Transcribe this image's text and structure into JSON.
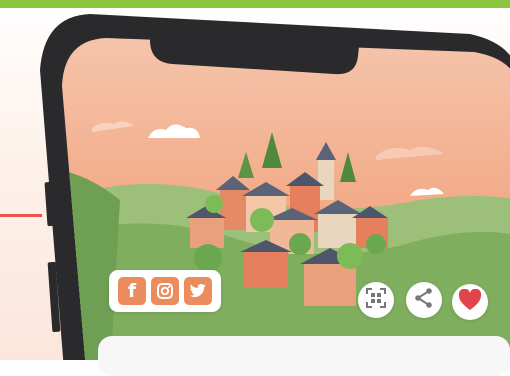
{
  "colors": {
    "top_bar": "#8cc63f",
    "accent_line": "#e8534d",
    "phone_frame": "#2a2a2c",
    "sky": "#f2a986",
    "hills": "#7fae5e",
    "social_icon": "#ea8c5c",
    "heart": "#e1444a"
  },
  "social": {
    "facebook_icon": "facebook-icon",
    "instagram_icon": "instagram-icon",
    "twitter_icon": "twitter-icon"
  },
  "actions": {
    "qr_icon": "qr-code-icon",
    "share_icon": "share-icon",
    "heart_icon": "heart-icon"
  },
  "illustration": "village-on-hill"
}
